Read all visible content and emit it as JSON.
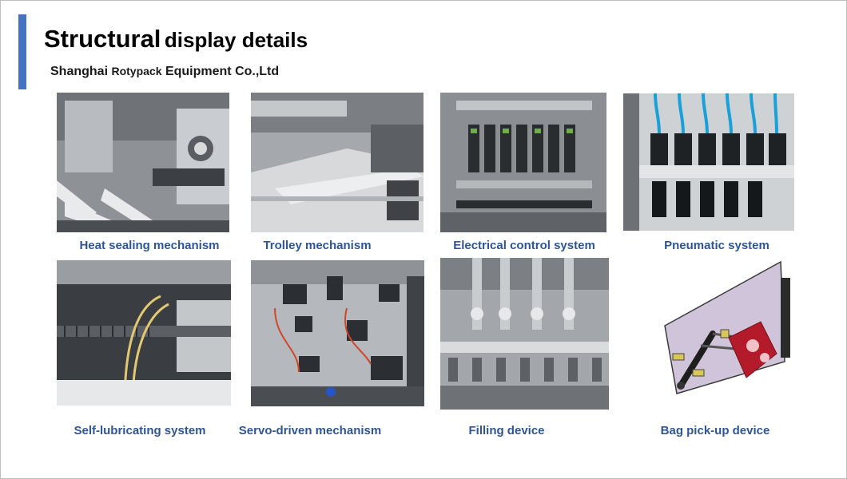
{
  "header": {
    "title_word": "Structural",
    "title_rest": "display details",
    "company_a": "Shanghai",
    "company_b": "Rotypack",
    "company_c": "Equipment Co.,Ltd"
  },
  "colors": {
    "accent": "#4472c4",
    "caption": "#2e5597"
  },
  "items": [
    {
      "caption": "Heat sealing mechanism"
    },
    {
      "caption": "Trolley mechanism"
    },
    {
      "caption": "Electrical control system"
    },
    {
      "caption": "Pneumatic system"
    },
    {
      "caption": "Self-lubricating system"
    },
    {
      "caption": "Servo-driven mechanism"
    },
    {
      "caption": "Filling device"
    },
    {
      "caption": "Bag pick-up device"
    }
  ]
}
